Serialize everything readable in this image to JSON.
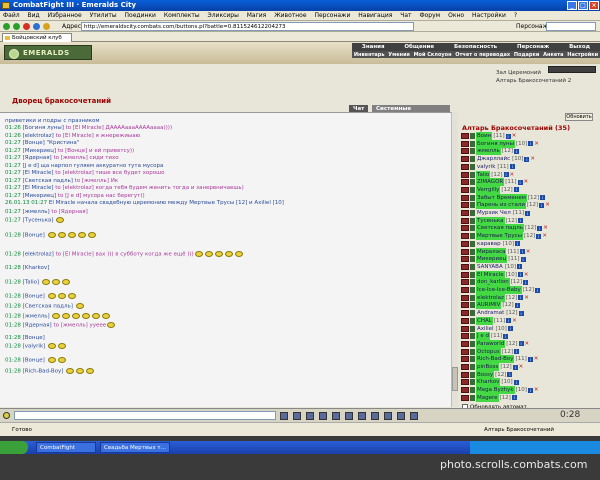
{
  "window": {
    "title": "CombatFight III · Emeralds City"
  },
  "menu": [
    "Файл",
    "Вид",
    "Избранное",
    "Утилиты",
    "Поединки",
    "Комплекты",
    "Эликсиры",
    "Магия",
    "Животное",
    "Персонажи",
    "Навигация",
    "Чат",
    "Форум",
    "Окно",
    "Настройки",
    "?"
  ],
  "address": {
    "label": "Адрес:",
    "url": "http://emeraldscity.combats.com/buttons.pl?battle=0.811524612204273"
  },
  "person_label": "Персонаж:",
  "tab": {
    "label": "Бойцовский клуб"
  },
  "logo": "EMERALDS",
  "topnav1": [
    "Знания",
    "Общение",
    "Безопасность",
    "Персонаж",
    "Выход"
  ],
  "topnav2": [
    "Инвентарь",
    "Умения",
    "Мой Склоуон",
    "Отчет о переводах",
    "Подарки",
    "Анкета",
    "Настройки"
  ],
  "room": {
    "title": "Дворец бракосочетаний"
  },
  "location": {
    "line1": "Зал Церемоний",
    "line2": "Алтарь Бракосочетаний 2"
  },
  "chat_tabs": {
    "chat": "Чат",
    "system": "Системные сообщения"
  },
  "chat": [
    {
      "time": "",
      "text": "приветики и подры с празником"
    },
    {
      "time": "01:26",
      "nick": "[Богиня луны]",
      "text": "to [El Miracle] ДААААаааААААаааа))))"
    },
    {
      "time": "01:26",
      "nick": "[elektrolaz]",
      "text": "to [El Miracle] я жнережиыаю"
    },
    {
      "time": "01:27",
      "nick": "[Вонце]",
      "text": "\"Кристина\""
    },
    {
      "time": "01:27",
      "nick": "[Микериец]",
      "text": "to [Вонце] и ей приветсу))"
    },
    {
      "time": "01:27",
      "nick": "[Ядерная]",
      "text": "to [жмелль] сиди тихо"
    },
    {
      "time": "01:27",
      "nick": "[J e d]",
      "text": "ща нарпол гуляем аккуратно тута мусора"
    },
    {
      "time": "01:27",
      "nick": "[El Miracle]",
      "text": "to [elektrolaz] тише все будет хорошо"
    },
    {
      "time": "01:27",
      "nick": "[Светская падль]",
      "text": "to [жмелль] Ик"
    },
    {
      "time": "01:27",
      "nick": "[El Miracle]",
      "text": "to [elektrolaz] когда тебя будем женить тогда и занервничаешь)"
    },
    {
      "time": "01:27",
      "nick": "[Микериец]",
      "text": "to [J e d] мусора нас берегут))"
    },
    {
      "time": "26.01.13 01:27",
      "nick": "",
      "text": "El Miracle начала свадебную церемонию между  Мертвые Трусы [12]  и  Axiliel [10]"
    },
    {
      "time": "01:27",
      "nick": "[жмелль]",
      "text": "to [Ядерная]"
    },
    {
      "time": "01:27",
      "nick": "[Тусенька]",
      "text": ""
    },
    {
      "time": "01:28",
      "nick": "[Вонце]",
      "text": ""
    },
    {
      "time": "01:28",
      "nick": "[elektrolaz]",
      "text": "to [El Miracle] вах ))) в субботу когда же ещё )))"
    },
    {
      "time": "01:28",
      "nick": "[Kharkov]",
      "text": ""
    },
    {
      "time": "01:28",
      "nick": "[Talio]",
      "text": ""
    },
    {
      "time": "01:28",
      "nick": "[Вонце]",
      "text": ""
    },
    {
      "time": "01:28",
      "nick": "[Светская падль]",
      "text": ""
    },
    {
      "time": "01:28",
      "nick": "[жмелль]",
      "text": ""
    },
    {
      "time": "01:28",
      "nick": "[Ядерная]",
      "text": "to [жмелль] ууеее"
    },
    {
      "time": "01:28",
      "nick": "[Вонце]",
      "text": ""
    },
    {
      "time": "01:28",
      "nick": "[valyrik]",
      "text": ""
    },
    {
      "time": "01:28",
      "nick": "[Вонце]",
      "text": ""
    },
    {
      "time": "01:28",
      "nick": "[Rich-Bad-Boy]",
      "text": ""
    }
  ],
  "refresh_label": "Обновить",
  "players_title": "Алтарь Бракосочетаний (35)",
  "players": [
    {
      "name": "Воин",
      "lv": "[11]",
      "hl": true
    },
    {
      "name": "Богиня луны",
      "lv": "[10]",
      "hl": true
    },
    {
      "name": "жмелль",
      "lv": "[12]",
      "hl": true
    },
    {
      "name": "Джарллайс",
      "lv": "[10]",
      "hl": false
    },
    {
      "name": "valyrik",
      "lv": "[11]",
      "hl": false
    },
    {
      "name": "Talio",
      "lv": "[12]",
      "hl": true
    },
    {
      "name": "ZIMAGOR",
      "lv": "[11]",
      "hl": true
    },
    {
      "name": "Verrgilly",
      "lv": "[12]",
      "hl": true
    },
    {
      "name": "Забыт Временем",
      "lv": "[12]",
      "hl": true
    },
    {
      "name": "Парень из стали",
      "lv": "[12]",
      "hl": true
    },
    {
      "name": "Мурзик Чел",
      "lv": "[11]",
      "hl": false
    },
    {
      "name": "Тусенька",
      "lv": "[12]",
      "hl": true
    },
    {
      "name": "Светская падль",
      "lv": "[12]",
      "hl": true
    },
    {
      "name": "Мертвые Трусы",
      "lv": "[12]",
      "hl": true
    },
    {
      "name": "каравар",
      "lv": "[10]",
      "hl": false
    },
    {
      "name": "Мираласа",
      "lv": "[11]",
      "hl": true
    },
    {
      "name": "Микериец",
      "lv": "[11]",
      "hl": true
    },
    {
      "name": "SANYABA",
      "lv": "[10]",
      "hl": false
    },
    {
      "name": "El Miracle",
      "lv": "[10]",
      "hl": true
    },
    {
      "name": "don_karlion",
      "lv": "[12]",
      "hl": true
    },
    {
      "name": "Ice-Ice-Ice-Baby",
      "lv": "[12]",
      "hl": true
    },
    {
      "name": "elektrolaz",
      "lv": "[12]",
      "hl": true
    },
    {
      "name": "AURIMIV",
      "lv": "[12]",
      "hl": true
    },
    {
      "name": "Andramat",
      "lv": "[12]",
      "hl": false
    },
    {
      "name": "CHAL",
      "lv": "[11]",
      "hl": true
    },
    {
      "name": "Axiliel",
      "lv": "[10]",
      "hl": false
    },
    {
      "name": "J e d",
      "lv": "[11]",
      "hl": true
    },
    {
      "name": "Paraworld",
      "lv": "[12]",
      "hl": true
    },
    {
      "name": "Octopus",
      "lv": "[12]",
      "hl": true
    },
    {
      "name": "Rich-Bad-Boy",
      "lv": "[11]",
      "hl": true
    },
    {
      "name": "pinBoss",
      "lv": "[12]",
      "hl": true
    },
    {
      "name": "Bossy",
      "lv": "[12]",
      "hl": true
    },
    {
      "name": "Kharkov",
      "lv": "[10]",
      "hl": true
    },
    {
      "name": "Mega Byzhyk",
      "lv": "[10]",
      "hl": true
    },
    {
      "name": "Magere",
      "lv": "[12]",
      "hl": true
    }
  ],
  "auto_refresh_label": "Обновлять автомат.",
  "statusbar": {
    "left": "Готово",
    "right": "Алтарь Бракосочетаний"
  },
  "taskbar": {
    "start": "",
    "task1": "CombatFight",
    "task2": "Свадьба Мертвых т...",
    "clock": "0:28"
  },
  "watermark": "photo.scrolls.combats.com"
}
